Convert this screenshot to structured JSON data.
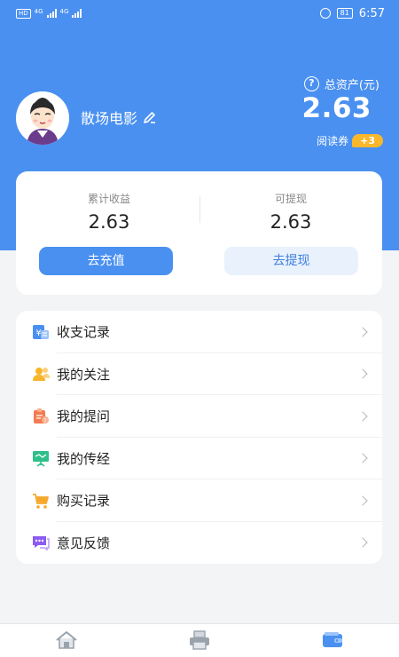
{
  "status_bar": {
    "chip1": "HD",
    "net1": "4G",
    "net2": "4G",
    "battery": "81",
    "time": "6:57"
  },
  "profile": {
    "username": "散场电影",
    "total_assets_label": "总资产(元)",
    "total_assets_value": "2.63",
    "coupon_label": "阅读券",
    "coupon_badge": "+3"
  },
  "earnings": {
    "cumulative_label": "累计收益",
    "cumulative_value": "2.63",
    "withdrawable_label": "可提现",
    "withdrawable_value": "2.63",
    "recharge_button": "去充值",
    "withdraw_button": "去提现"
  },
  "menu": {
    "items": [
      {
        "label": "收支记录",
        "icon": "wallet-record-icon",
        "color": "#4a8ff0"
      },
      {
        "label": "我的关注",
        "icon": "follow-users-icon",
        "color": "#f7b52c"
      },
      {
        "label": "我的提问",
        "icon": "question-clipboard-icon",
        "color": "#f37b50"
      },
      {
        "label": "我的传经",
        "icon": "presentation-icon",
        "color": "#2fbf8a"
      },
      {
        "label": "购买记录",
        "icon": "shopping-cart-icon",
        "color": "#f7a72c"
      },
      {
        "label": "意见反馈",
        "icon": "feedback-chat-icon",
        "color": "#8c5bf2"
      }
    ]
  },
  "bottom_nav": {
    "items": [
      {
        "icon": "home-icon",
        "active": false
      },
      {
        "icon": "printer-icon",
        "active": false
      },
      {
        "icon": "wallet-icon",
        "active": true
      }
    ]
  },
  "colors": {
    "brand_blue": "#4a90f0",
    "coupon_yellow": "#f9b72b",
    "background": "#f3f4f6"
  }
}
